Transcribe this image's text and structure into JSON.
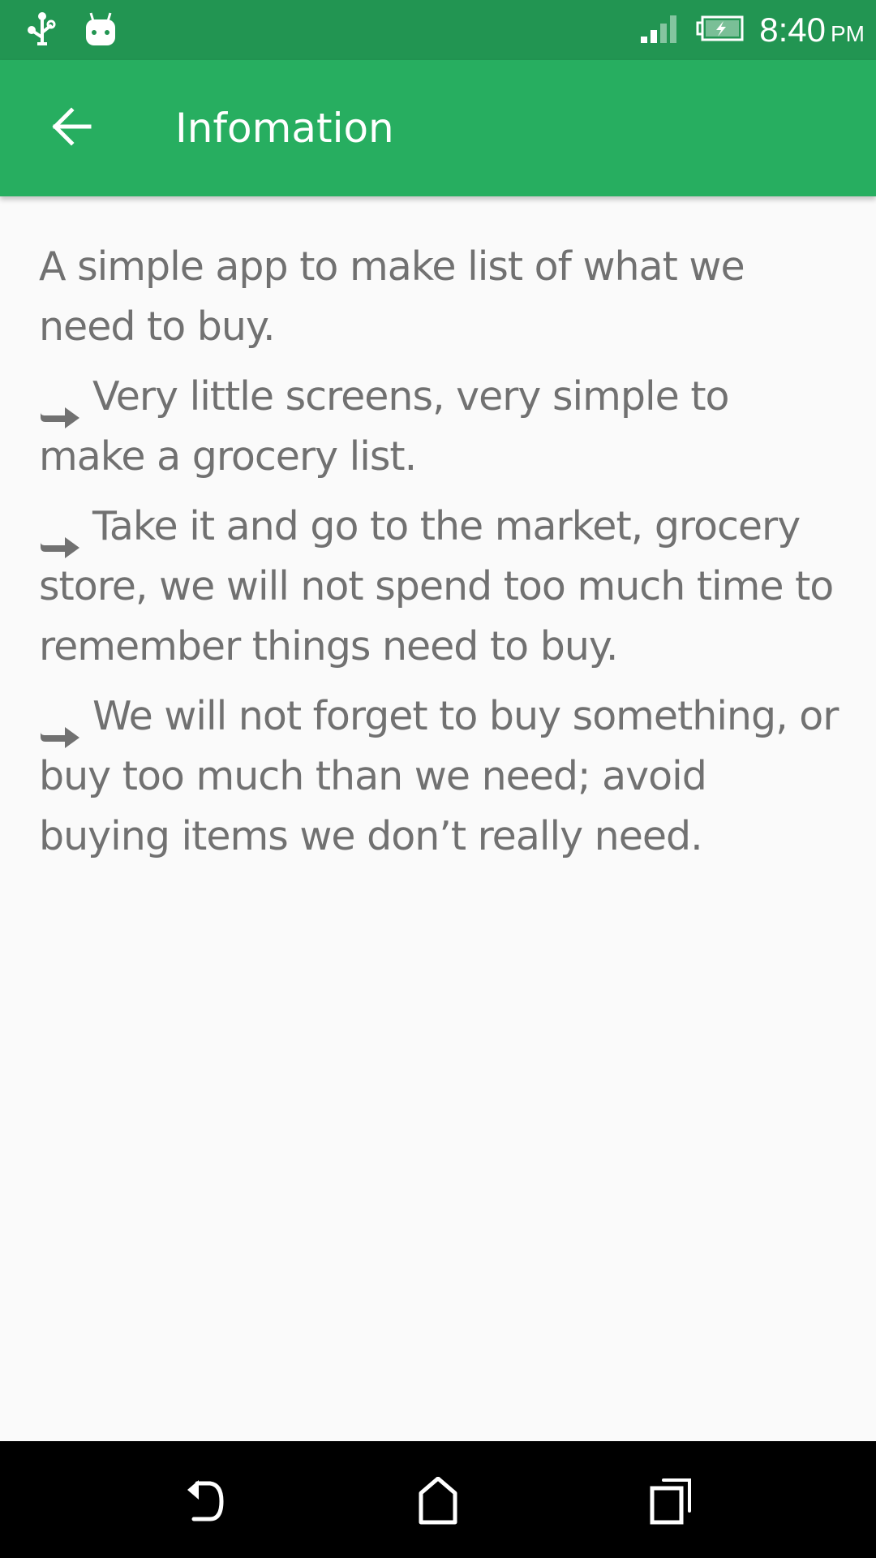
{
  "status_bar": {
    "icons": [
      "usb-icon",
      "android-icon",
      "signal-icon",
      "battery-charging-icon"
    ],
    "time": "8:40",
    "ampm": "PM"
  },
  "toolbar": {
    "back_icon": "arrow-left-icon",
    "title": "Infomation"
  },
  "content": {
    "intro": "A simple app to make list of what we need to buy.",
    "bullet_icon": "right-arrow-bullet-icon",
    "points": [
      "Very little screens, very simple to make a grocery list.",
      "Take it and go to the market, gro­cery store, we will not spend too much time to remember things need to buy.",
      "We will not forget to buy something, or buy too much than we need; avoid buying items we don’t really need."
    ]
  },
  "nav_bar": {
    "buttons": [
      "back",
      "home",
      "recents"
    ]
  },
  "colors": {
    "status_bar": "#229552",
    "toolbar": "#27ae60",
    "text": "#717171",
    "background": "#fafafa"
  }
}
